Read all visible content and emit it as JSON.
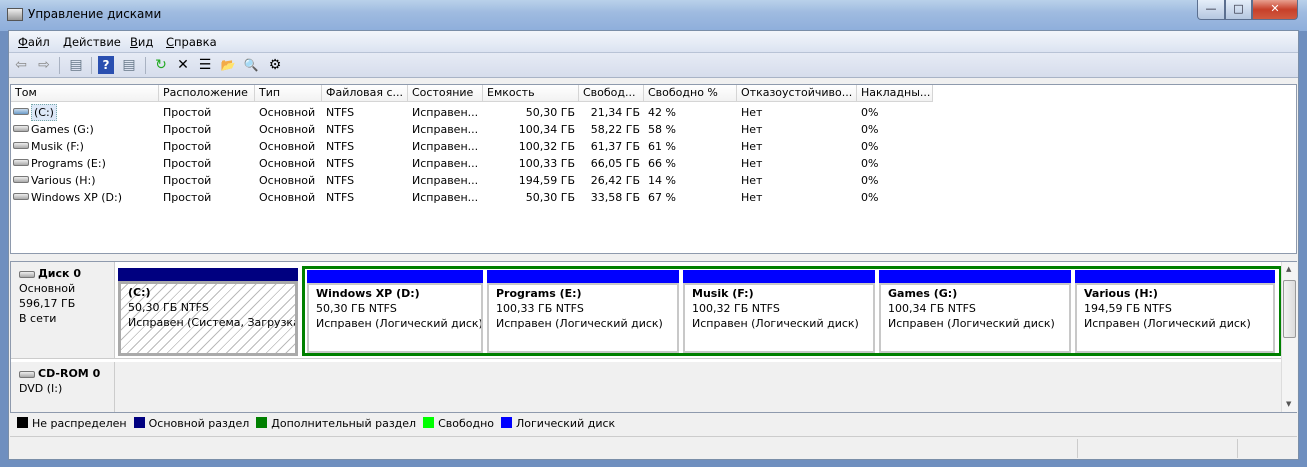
{
  "window": {
    "title": "Управление дисками",
    "minimize": "—",
    "maximize": "□",
    "close": "✕"
  },
  "menu": [
    {
      "label": "Файл"
    },
    {
      "label": "Действие"
    },
    {
      "label": "Вид"
    },
    {
      "label": "Справка"
    }
  ],
  "toolbar": {
    "back": "⇦",
    "forward": "⇨",
    "console_tree": "▤",
    "help": "?",
    "action_pane": "▤",
    "refresh": "↻",
    "delete": "✕",
    "properties": "☰",
    "open": "📂",
    "explore": "🔍",
    "settings": "⚙"
  },
  "columns": [
    "Том",
    "Расположение",
    "Тип",
    "Файловая с...",
    "Состояние",
    "Емкость",
    "Свобод...",
    "Свободно %",
    "Отказоустойчиво...",
    "Накладны..."
  ],
  "volumes": [
    [
      "(C:)",
      "Простой",
      "Основной",
      "NTFS",
      "Исправен...",
      "50,30 ГБ",
      "21,34 ГБ",
      "42 %",
      "Нет",
      "0%"
    ],
    [
      "Games (G:)",
      "Простой",
      "Основной",
      "NTFS",
      "Исправен...",
      "100,34 ГБ",
      "58,22 ГБ",
      "58 %",
      "Нет",
      "0%"
    ],
    [
      "Musik (F:)",
      "Простой",
      "Основной",
      "NTFS",
      "Исправен...",
      "100,32 ГБ",
      "61,37 ГБ",
      "61 %",
      "Нет",
      "0%"
    ],
    [
      "Programs (E:)",
      "Простой",
      "Основной",
      "NTFS",
      "Исправен...",
      "100,33 ГБ",
      "66,05 ГБ",
      "66 %",
      "Нет",
      "0%"
    ],
    [
      "Various (H:)",
      "Простой",
      "Основной",
      "NTFS",
      "Исправен...",
      "194,59 ГБ",
      "26,42 ГБ",
      "14 %",
      "Нет",
      "0%"
    ],
    [
      "Windows XP (D:)",
      "Простой",
      "Основной",
      "NTFS",
      "Исправен...",
      "50,30 ГБ",
      "33,58 ГБ",
      "67 %",
      "Нет",
      "0%"
    ]
  ],
  "disk0": {
    "name": "Диск 0",
    "type": "Основной",
    "size": "596,17 ГБ",
    "status": "В сети",
    "partitions": [
      {
        "name": "(C:)",
        "size": "50,30 ГБ NTFS",
        "status": "Исправен (Система, Загрузка,"
      },
      {
        "name": "Windows XP  (D:)",
        "size": "50,30 ГБ NTFS",
        "status": "Исправен (Логический диск)"
      },
      {
        "name": "Programs  (E:)",
        "size": "100,33 ГБ NTFS",
        "status": "Исправен (Логический диск)"
      },
      {
        "name": "Musik  (F:)",
        "size": "100,32 ГБ NTFS",
        "status": "Исправен (Логический диск)"
      },
      {
        "name": "Games  (G:)",
        "size": "100,34 ГБ NTFS",
        "status": "Исправен (Логический диск)"
      },
      {
        "name": "Various  (H:)",
        "size": "194,59 ГБ NTFS",
        "status": "Исправен (Логический диск)"
      }
    ]
  },
  "cdrom0": {
    "name": "CD-ROM 0",
    "drive": "DVD (I:)"
  },
  "legend": [
    {
      "label": "Не распределен",
      "color": "#000000"
    },
    {
      "label": "Основной раздел",
      "color": "#000080"
    },
    {
      "label": "Дополнительный раздел",
      "color": "#008000"
    },
    {
      "label": "Свободно",
      "color": "#00ff00"
    },
    {
      "label": "Логический диск",
      "color": "#0000ff"
    }
  ]
}
